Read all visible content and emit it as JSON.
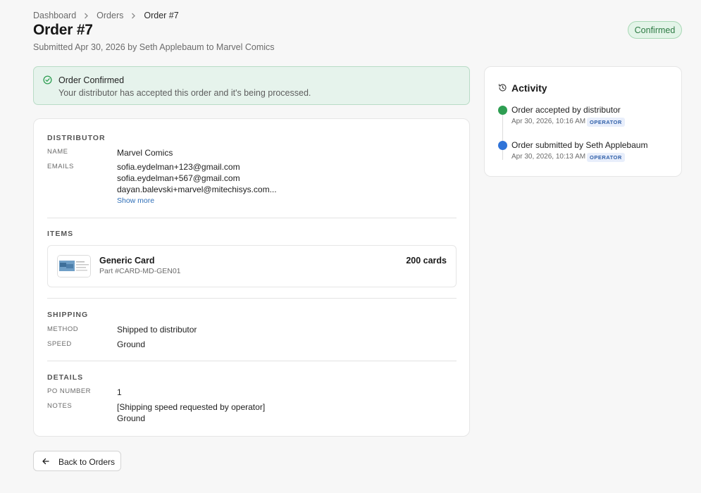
{
  "breadcrumb": [
    "Dashboard",
    "Orders",
    "Order #7"
  ],
  "header": {
    "title": "Order #7",
    "subtitle": "Submitted Apr 30, 2026 by Seth Applebaum to Marvel Comics",
    "status": "Confirmed"
  },
  "alert": {
    "icon": "check-circle-icon",
    "title": "Order Confirmed",
    "message": "Your distributor has accepted this order and it's being processed."
  },
  "distributor": {
    "section": "DISTRIBUTOR",
    "name_label": "NAME",
    "name": "Marvel Comics",
    "emails_label": "EMAILS",
    "emails": [
      "sofia.eydelman+123@gmail.com",
      "sofia.eydelman+567@gmail.com",
      "dayan.balevski+marvel@mitechisys.com..."
    ],
    "show_more": "Show more"
  },
  "items": {
    "section": "ITEMS",
    "list": [
      {
        "name": "Generic Card",
        "part": "Part #CARD-MD-GEN01",
        "quantity": "200 cards"
      }
    ]
  },
  "shipping": {
    "section": "SHIPPING",
    "method_label": "METHOD",
    "method": "Shipped to distributor",
    "speed_label": "SPEED",
    "speed": "Ground"
  },
  "details": {
    "section": "DETAILS",
    "po_label": "PO NUMBER",
    "po": "1",
    "notes_label": "NOTES",
    "notes_line1": "[Shipping speed requested by operator]",
    "notes_line2": "Ground"
  },
  "activity": {
    "icon": "history-icon",
    "title": "Activity",
    "events": [
      {
        "title": "Order accepted by distributor",
        "time": "Apr 30, 2026, 10:16 AM",
        "badge": "OPERATOR",
        "color": "#2e9e52"
      },
      {
        "title": "Order submitted by Seth Applebaum",
        "time": "Apr 30, 2026, 10:13 AM",
        "badge": "OPERATOR",
        "color": "#2f73d8"
      }
    ]
  },
  "back_button": {
    "label": "Back to Orders",
    "icon": "arrow-left-icon"
  },
  "colors": {
    "confirmed_green": "#2d7a43",
    "link_blue": "#2f6fb8"
  }
}
